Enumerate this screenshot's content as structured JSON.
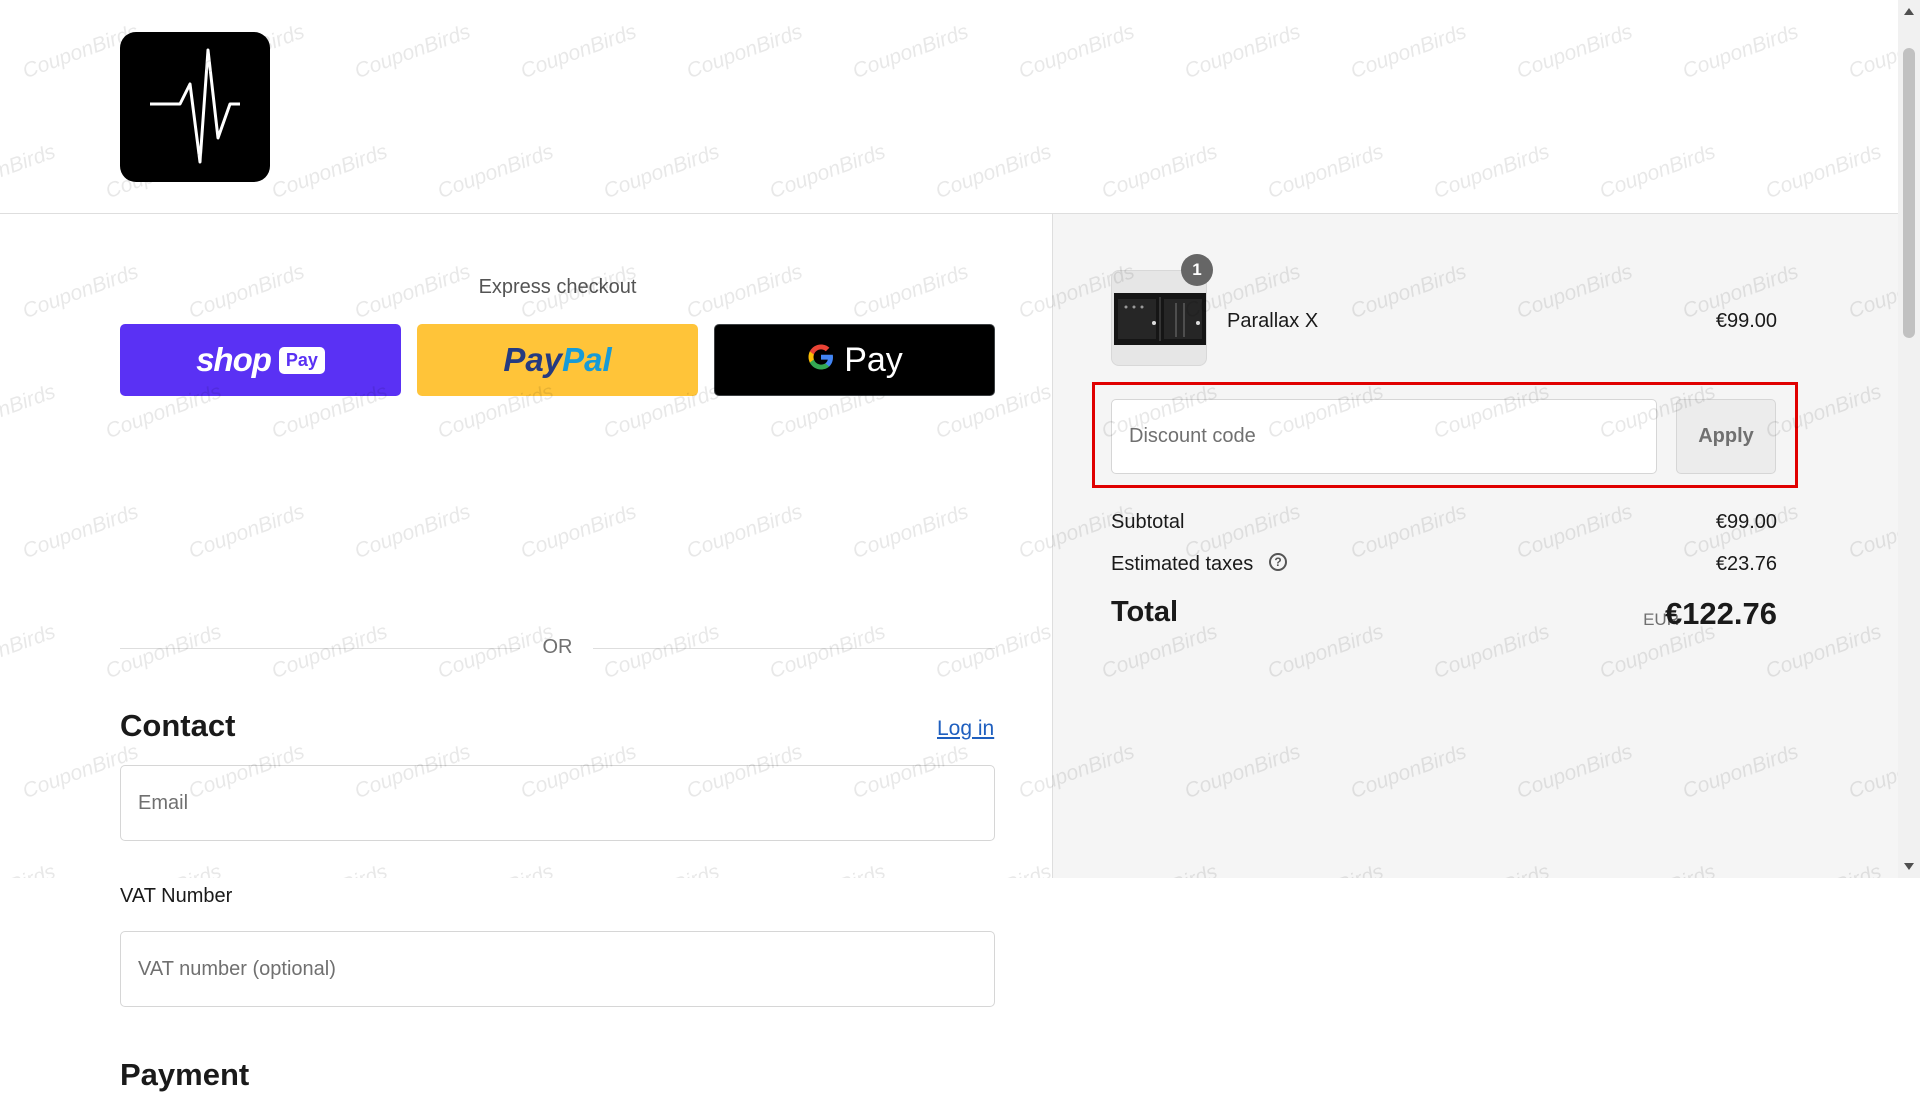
{
  "store": {
    "logo_icon": "heartbeat-icon"
  },
  "express": {
    "title": "Express checkout",
    "shop_pay": {
      "word": "shop",
      "badge": "Pay"
    },
    "paypal": {
      "pay": "Pay",
      "pal": "Pal"
    },
    "gpay": {
      "g": "G",
      "word": "Pay"
    },
    "or": "OR"
  },
  "contact": {
    "title": "Contact",
    "login_link": "Log in",
    "email_placeholder": "Email"
  },
  "vat": {
    "label": "VAT Number",
    "placeholder": "VAT number (optional)"
  },
  "payment": {
    "title": "Payment"
  },
  "order": {
    "items": [
      {
        "name": "Parallax X",
        "price": "€99.00",
        "quantity": "1"
      }
    ]
  },
  "discount": {
    "placeholder": "Discount code",
    "apply_label": "Apply"
  },
  "summary": {
    "subtotal_label": "Subtotal",
    "subtotal_value": "€99.00",
    "taxes_label": "Estimated taxes",
    "taxes_help_icon": "help-circle-icon",
    "taxes_value": "€23.76",
    "total_label": "Total",
    "total_currency": "EUR",
    "total_value": "€122.76"
  },
  "watermark": {
    "text": "CouponBirds"
  },
  "colors": {
    "shop_pay": "#5a31f4",
    "paypal": "#ffc439",
    "gpay": "#000000",
    "highlight": "#e00000",
    "link": "#1f5fbf"
  }
}
